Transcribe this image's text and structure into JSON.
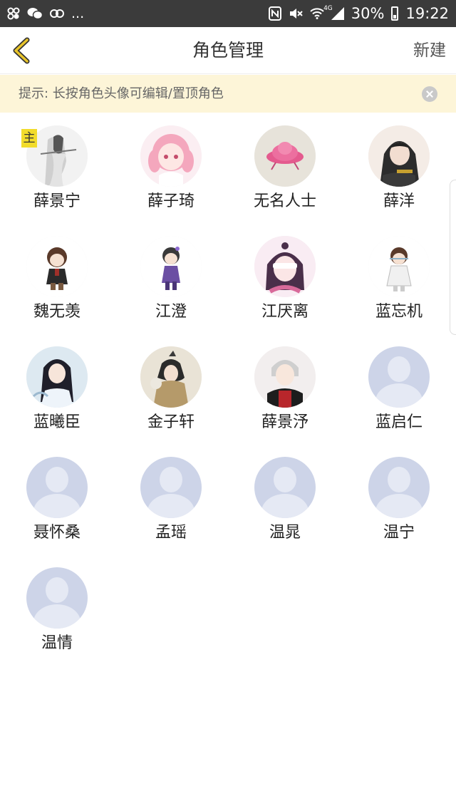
{
  "status": {
    "left_icons": [
      "app-icon",
      "wechat-icon",
      "link-icon"
    ],
    "dots": "...",
    "right_icons": [
      "nfc-icon",
      "mute-icon",
      "wifi-icon",
      "signal-icon"
    ],
    "network": "4G",
    "battery": "30%",
    "time": "19:22"
  },
  "header": {
    "back_icon": "chevron-left-icon",
    "title": "角色管理",
    "new_label": "新建"
  },
  "tip": {
    "text": "提示: 长按角色头像可编辑/置顶角色",
    "close_icon": "close-icon"
  },
  "main_badge": "主",
  "colors": {
    "accent": "#f2dc2b",
    "tip_bg": "#fdf5d8",
    "placeholder": "#cdd4e8"
  },
  "characters": [
    {
      "name": "薛景宁",
      "avatar": "custom"
    },
    {
      "name": "薛子琦",
      "avatar": "custom"
    },
    {
      "name": "无名人士",
      "avatar": "custom"
    },
    {
      "name": "薛洋",
      "avatar": "custom"
    },
    {
      "name": "魏无羡",
      "avatar": "custom"
    },
    {
      "name": "江澄",
      "avatar": "custom"
    },
    {
      "name": "江厌离",
      "avatar": "custom"
    },
    {
      "name": "蓝忘机",
      "avatar": "custom"
    },
    {
      "name": "蓝曦臣",
      "avatar": "custom"
    },
    {
      "name": "金子轩",
      "avatar": "custom"
    },
    {
      "name": "薛景汿",
      "avatar": "custom"
    },
    {
      "name": "蓝启仁",
      "avatar": "placeholder"
    },
    {
      "name": "聂怀桑",
      "avatar": "placeholder"
    },
    {
      "name": "孟瑶",
      "avatar": "placeholder"
    },
    {
      "name": "温晁",
      "avatar": "placeholder"
    },
    {
      "name": "温宁",
      "avatar": "placeholder"
    },
    {
      "name": "温情",
      "avatar": "placeholder"
    }
  ]
}
